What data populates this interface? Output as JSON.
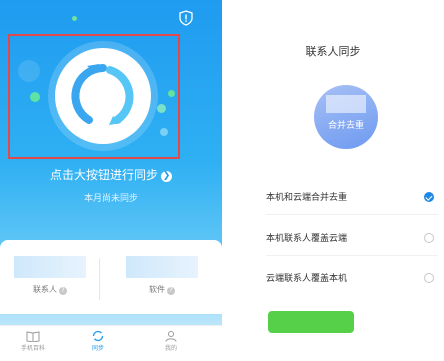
{
  "left_panel": {
    "sync_hint": "点击大按钮进行同步",
    "month_status": "本月尚未同步",
    "cards": [
      {
        "label": "联系人"
      },
      {
        "label": "软件"
      }
    ],
    "tabs": [
      {
        "label": "手机百科",
        "icon": "book-icon"
      },
      {
        "label": "同步",
        "icon": "sync-icon"
      },
      {
        "label": "我的",
        "icon": "person-icon"
      }
    ],
    "active_tab": "同步",
    "accent_color": "#1f9bf0"
  },
  "right_panel": {
    "title": "联系人同步",
    "merge_label": "合并去重",
    "options": [
      {
        "label": "本机和云端合并去重",
        "checked": true
      },
      {
        "label": "本机联系人覆盖云端",
        "checked": false
      },
      {
        "label": "云端联系人覆盖本机",
        "checked": false
      }
    ],
    "confirm_color": "#57d049"
  }
}
